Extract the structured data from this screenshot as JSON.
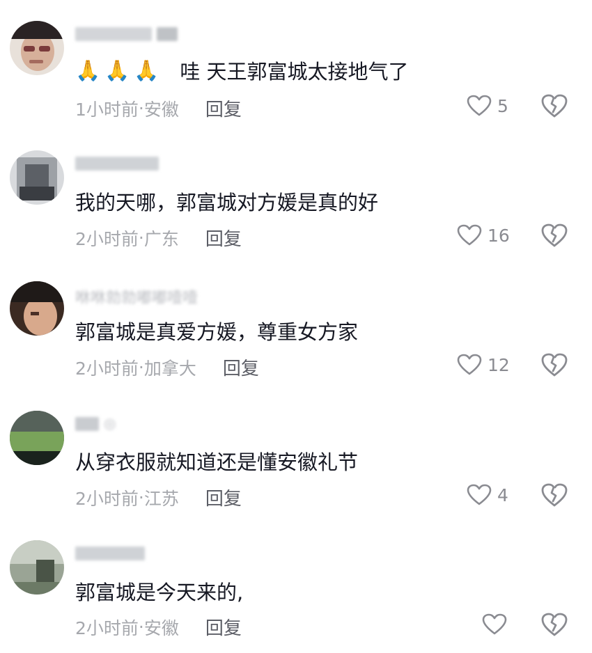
{
  "comments": [
    {
      "username": "I··· ··· 食肯",
      "emojis": [
        "🙏",
        "🙏",
        "🙏"
      ],
      "text": "哇 天王郭富城太接地气了",
      "time": "1小时前",
      "location": "安徽",
      "reply_label": "回复",
      "likes": "5",
      "avatar_colors": [
        "#e9e2da",
        "#caa48d",
        "#1e1a22"
      ]
    },
    {
      "username": "晓··· 怀诺",
      "emojis": [],
      "text": "我的天哪，郭富城对方媛是真的好",
      "time": "2小时前",
      "location": "广东",
      "reply_label": "回复",
      "likes": "16",
      "avatar_colors": [
        "#cfd3d8",
        "#8c8f93",
        "#3b3e43"
      ]
    },
    {
      "username": "咻咻勍勍嘟嘟噎噎",
      "emojis": [],
      "text": "郭富城是真爱方媛，尊重女方家",
      "time": "2小时前",
      "location": "加拿大",
      "reply_label": "回复",
      "likes": "12",
      "avatar_colors": [
        "#5a3a2c",
        "#d6a78a",
        "#26211f"
      ]
    },
    {
      "username": "口◎",
      "emojis": [],
      "text": "从穿衣服就知道还是懂安徽礼节",
      "time": "2小时前",
      "location": "江苏",
      "reply_label": "回复",
      "likes": "4",
      "avatar_colors": [
        "#3f4d43",
        "#6f9a54",
        "#1d2a22"
      ]
    },
    {
      "username": "新··· 主",
      "emojis": [],
      "text": "郭富城是今天来的,",
      "time": "2小时前",
      "location": "安徽",
      "reply_label": "回复",
      "likes": "",
      "avatar_colors": [
        "#8f9a8a",
        "#c9d0c6",
        "#3f4a3b"
      ]
    }
  ],
  "meta_separator": " · ",
  "icons": {
    "like": "heart-outline-icon",
    "dislike": "broken-heart-icon"
  }
}
